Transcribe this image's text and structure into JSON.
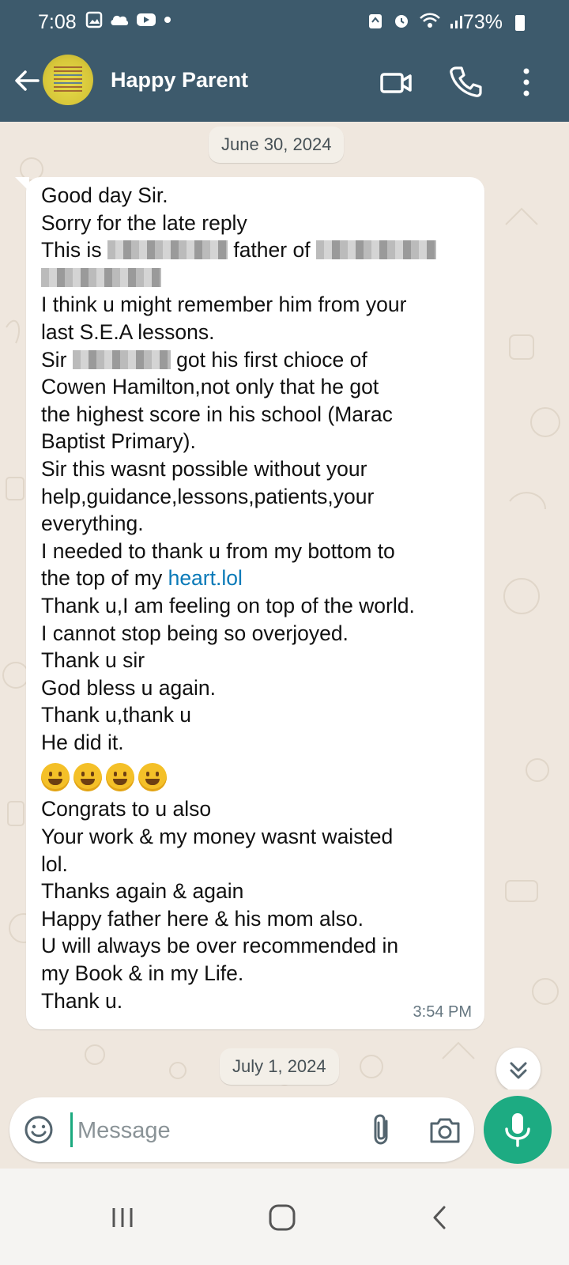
{
  "status_bar": {
    "time": "7:08",
    "battery": "73%",
    "left_icons": [
      "gallery-icon",
      "cloud-icon",
      "youtube-icon",
      "dot-icon"
    ],
    "right_icons": [
      "recycle-icon",
      "alarm-icon",
      "wifi-icon",
      "signal-icon",
      "battery-icon"
    ]
  },
  "header": {
    "contact_name": "Happy Parent",
    "avatar_text": [
      "$50,000 TTD",
      "to",
      "$100,000 TTD"
    ],
    "actions": [
      "video-call-icon",
      "phone-icon",
      "more-vert-icon"
    ]
  },
  "chat": {
    "date_separator_1": "June 30, 2024",
    "date_separator_2": "July 1, 2024",
    "message": {
      "lines": [
        "Good day Sir.",
        "Sorry for the late reply",
        "This is",
        "father of",
        "I think u might remember him from your",
        "last S.E.A lessons.",
        "Sir",
        "got his first chioce of",
        "Cowen Hamilton,not only that he got",
        "the highest score in his school (Marac",
        "Baptist Primary).",
        "Sir this wasnt possible without your",
        "help,guidance,lessons,patients,your",
        "everything.",
        "I needed to thank u from my bottom to",
        "the top of my",
        "heart.lol",
        "Thank u,I am feeling on top of the world.",
        "I cannot stop being so overjoyed.",
        "Thank u sir",
        "God bless u again.",
        "Thank u,thank u",
        "He did it.",
        "Congrats to u also",
        "Your work & my money wasnt waisted",
        "lol.",
        "Thanks again & again",
        "Happy father here & his mom also.",
        "U will always be over recommended in",
        "my Book & in my Life.",
        "Thank u."
      ],
      "emojis": [
        "grinning-face",
        "smiling-face",
        "grinning-face",
        "smiling-face"
      ],
      "time": "3:54 PM"
    }
  },
  "composer": {
    "placeholder": "Message"
  },
  "nav_bar": [
    "recents-icon",
    "home-icon",
    "back-icon"
  ]
}
